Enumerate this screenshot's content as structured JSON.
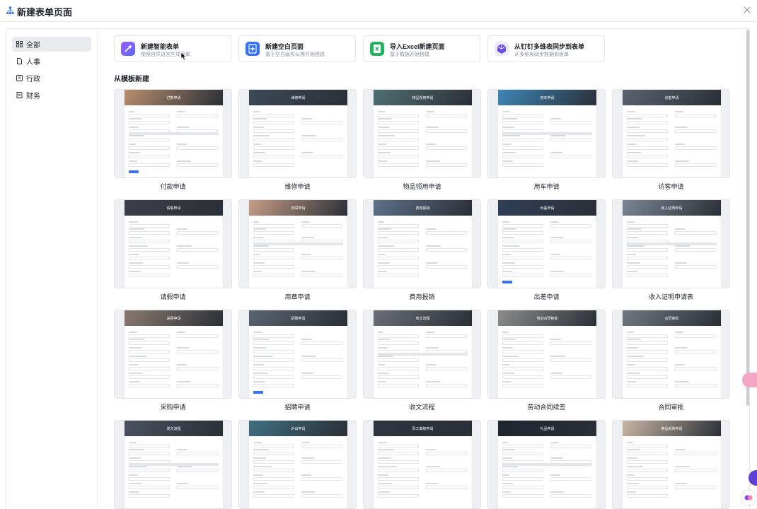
{
  "window": {
    "title": "新建表单页面"
  },
  "sidebar": {
    "items": [
      {
        "label": "全部",
        "icon": "grid-icon",
        "active": true
      },
      {
        "label": "人事",
        "icon": "document-icon",
        "active": false
      },
      {
        "label": "行政",
        "icon": "folder-icon",
        "active": false
      },
      {
        "label": "财务",
        "icon": "ledger-icon",
        "active": false
      }
    ]
  },
  "create_options": [
    {
      "title": "新建智能表单",
      "subtitle": "使用自然语言生成表单",
      "icon": "ai-magic-icon",
      "color": "#7b4dff"
    },
    {
      "title": "新建空白页面",
      "subtitle": "基于空白画布从零开始搭建",
      "icon": "plus-icon",
      "color": "#3370ff"
    },
    {
      "title": "导入Excel新建页面",
      "subtitle": "基于数据开始搭建",
      "icon": "excel-icon",
      "color": "#1fb55c"
    },
    {
      "title": "从钉钉多维表同步到表单",
      "subtitle": "从多维表同步数据到表单",
      "icon": "sync-cube-icon",
      "color": "#6b4ee6"
    }
  ],
  "templates_section": {
    "title": "从模板新建"
  },
  "templates": [
    {
      "label": "付款申请",
      "banner": "付款申请",
      "color": "#b98d6e"
    },
    {
      "label": "维修申请",
      "banner": "维修申请",
      "color": "#3c4a58"
    },
    {
      "label": "物品领用申请",
      "banner": "物品领用申请",
      "color": "#4f6f72"
    },
    {
      "label": "用车申请",
      "banner": "用车申请",
      "color": "#3d86b8"
    },
    {
      "label": "访客申请",
      "banner": "访客申请",
      "color": "#59636f"
    },
    {
      "label": "请假申请",
      "banner": "请假申请",
      "color": "#3a3f4a"
    },
    {
      "label": "用章申请",
      "banner": "用章申请",
      "color": "#c79d86"
    },
    {
      "label": "费用报销",
      "banner": "费用报销",
      "color": "#5d7189"
    },
    {
      "label": "出差申请",
      "banner": "出差申请",
      "color": "#2f3f57"
    },
    {
      "label": "收入证明申请表",
      "banner": "收入证明申请",
      "color": "#7a8794"
    },
    {
      "label": "采购申请",
      "banner": "采购申请",
      "color": "#8a7a70"
    },
    {
      "label": "招聘申请",
      "banner": "招聘申请",
      "color": "#5a6470"
    },
    {
      "label": "收文流程",
      "banner": "收文流程",
      "color": "#6b6f75"
    },
    {
      "label": "劳动合同续签",
      "banner": "劳动合同续签",
      "color": "#8c8c8c"
    },
    {
      "label": "合同审批",
      "banner": "合同审批",
      "color": "#6f7880"
    },
    {
      "label": "",
      "banner": "发文流程",
      "color": "#4a5260"
    },
    {
      "label": "",
      "banner": "外出申请",
      "color": "#3f6f80"
    },
    {
      "label": "",
      "banner": "员工离职申请",
      "color": "#2e3540"
    },
    {
      "label": "",
      "banner": "礼品申请",
      "color": "#1f2530"
    },
    {
      "label": "",
      "banner": "菜品采购申请",
      "color": "#c9b6a4"
    }
  ]
}
